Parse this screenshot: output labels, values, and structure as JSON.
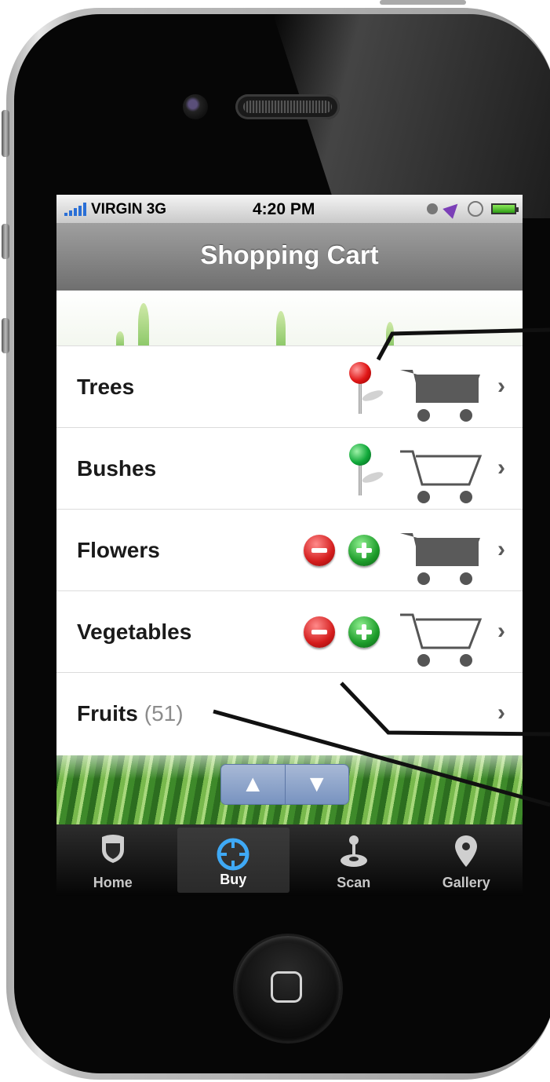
{
  "statusbar": {
    "carrier": "VIRGIN 3G",
    "time": "4:20 PM",
    "icons": [
      "signal-icon",
      "clock-icon",
      "location-icon",
      "rotation-lock-icon",
      "battery-icon"
    ]
  },
  "navbar": {
    "title": "Shopping Cart"
  },
  "list": {
    "items": [
      {
        "label": "Trees",
        "accessory": "red-pin-icon",
        "cart": "filled"
      },
      {
        "label": "Bushes",
        "accessory": "green-pin-icon",
        "cart": "outline"
      },
      {
        "label": "Flowers",
        "accessory": "minus-plus-buttons",
        "cart": "filled"
      },
      {
        "label": "Vegetables",
        "accessory": "minus-plus-buttons",
        "cart": "outline"
      },
      {
        "label": "Fruits",
        "count": "(51)"
      }
    ]
  },
  "pager": {
    "up": "▲",
    "down": "▼"
  },
  "tabbar": {
    "tabs": [
      {
        "label": "Home",
        "icon": "shield-icon"
      },
      {
        "label": "Buy",
        "icon": "crosshair-icon",
        "active": true
      },
      {
        "label": "Scan",
        "icon": "joystick-icon"
      },
      {
        "label": "Gallery",
        "icon": "map-pin-icon"
      }
    ]
  },
  "colors": {
    "navbar": "#8a8a8a",
    "pager": "#8aa1c9",
    "pin_red": "#e01616",
    "pin_green": "#11a93a",
    "minus": "#d41d1d",
    "plus": "#1d9c2a"
  }
}
